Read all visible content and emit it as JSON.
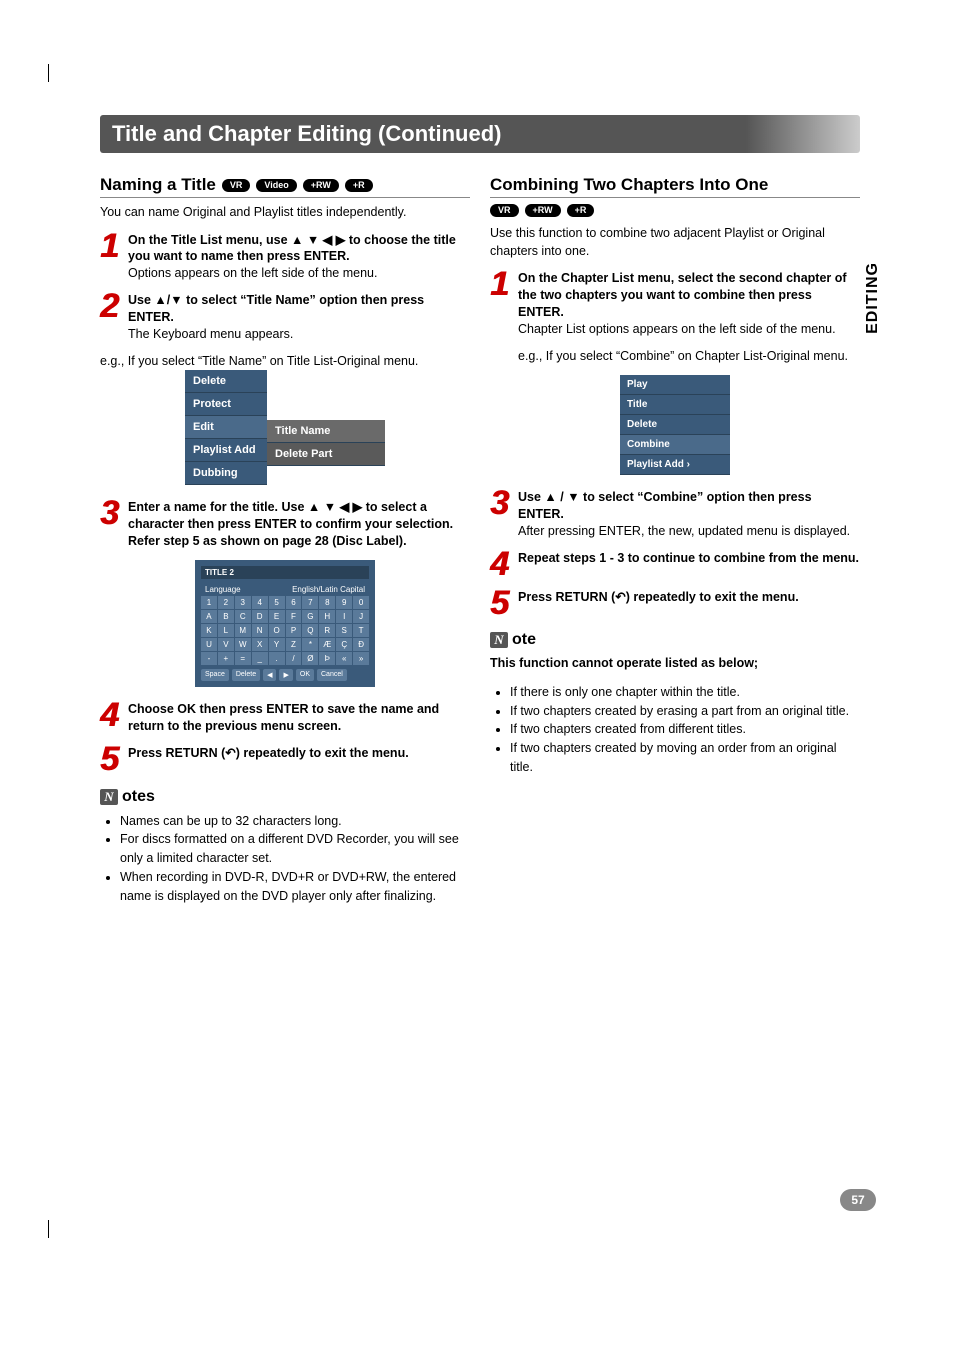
{
  "page": {
    "title": "Title and Chapter Editing (Continued)",
    "side_tab": "EDITING",
    "page_number": "57"
  },
  "left": {
    "heading": "Naming a Title",
    "badges": [
      "VR",
      "Video",
      "+RW",
      "+R"
    ],
    "intro": "You can name Original and Playlist titles independently.",
    "step1_bold": "On the Title List menu, use ▲ ▼ ◀ ▶ to choose the title you want to name then press ENTER.",
    "step1_sub": "Options appears on the left side of the menu.",
    "step2_bold": "Use ▲/▼ to select “Title Name” option then press ENTER.",
    "step2_sub": "The Keyboard menu appears.",
    "step2_eg": "e.g., If you select “Title Name” on Title List-Original menu.",
    "menu1": [
      "Delete",
      "Protect",
      "Edit",
      "Playlist Add",
      "Dubbing"
    ],
    "menu1_sub": [
      "Title Name",
      "Delete Part"
    ],
    "step3_bold": "Enter a name for the title. Use ▲ ▼ ◀ ▶ to select a character then press ENTER to confirm your selection. Refer step 5 as shown on page 28 (Disc Label).",
    "keyboard": {
      "title": "TITLE 2",
      "lang_label": "Language",
      "lang_value": "English/Latin Capital",
      "rows": [
        [
          "1",
          "2",
          "3",
          "4",
          "5",
          "6",
          "7",
          "8",
          "9",
          "0"
        ],
        [
          "A",
          "B",
          "C",
          "D",
          "E",
          "F",
          "G",
          "H",
          "I",
          "J"
        ],
        [
          "K",
          "L",
          "M",
          "N",
          "O",
          "P",
          "Q",
          "R",
          "S",
          "T"
        ],
        [
          "U",
          "V",
          "W",
          "X",
          "Y",
          "Z",
          "*",
          "Æ",
          "Ç",
          "Ð"
        ],
        [
          "-",
          "+",
          "=",
          "_",
          ".",
          "/",
          "Ø",
          "Þ",
          "«",
          "»"
        ]
      ],
      "buttons": [
        "Space",
        "Delete",
        "◀",
        "▶",
        "OK",
        "Cancel"
      ]
    },
    "step4_bold": "Choose OK then press ENTER to save the name and return to the previous menu screen.",
    "step5_bold": "Press RETURN (↶) repeatedly to exit the menu.",
    "notes_head": "otes",
    "notes": [
      "Names can be up to 32 characters long.",
      "For discs formatted on a different DVD Recorder, you will see only a limited character set.",
      "When recording in DVD-R, DVD+R or DVD+RW, the entered name is displayed on the DVD player only after finalizing."
    ]
  },
  "right": {
    "heading": "Combining Two Chapters Into One",
    "badges": [
      "VR",
      "+RW",
      "+R"
    ],
    "intro": "Use this function to combine two adjacent Playlist or Original chapters into one.",
    "step1_bold": "On the Chapter List menu, select the second chapter of the two chapters you want to combine then press ENTER.",
    "step1_sub": "Chapter List options appears on the left side of the menu.",
    "step1_eg": "e.g., If you select “Combine” on Chapter List-Original menu.",
    "menu": [
      "Play",
      "Title",
      "Delete",
      "Combine",
      "Playlist Add  ›"
    ],
    "step2_bold": "Use ▲ / ▼ to select “Combine” option then press ENTER.",
    "step2_sub": "After pressing ENTER, the new, updated menu is displayed.",
    "step3_bold": "Repeat steps 1 - 3 to continue to combine from the menu.",
    "step4_bold": "Press RETURN (↶) repeatedly to exit the menu.",
    "note_head": "ote",
    "note_intro": "This function cannot operate listed as below;",
    "note_items": [
      "If there is only one chapter within the title.",
      "If two chapters created by erasing a part from an original title.",
      "If two chapters created from different titles.",
      "If two chapters created by moving an order from an original title."
    ]
  }
}
